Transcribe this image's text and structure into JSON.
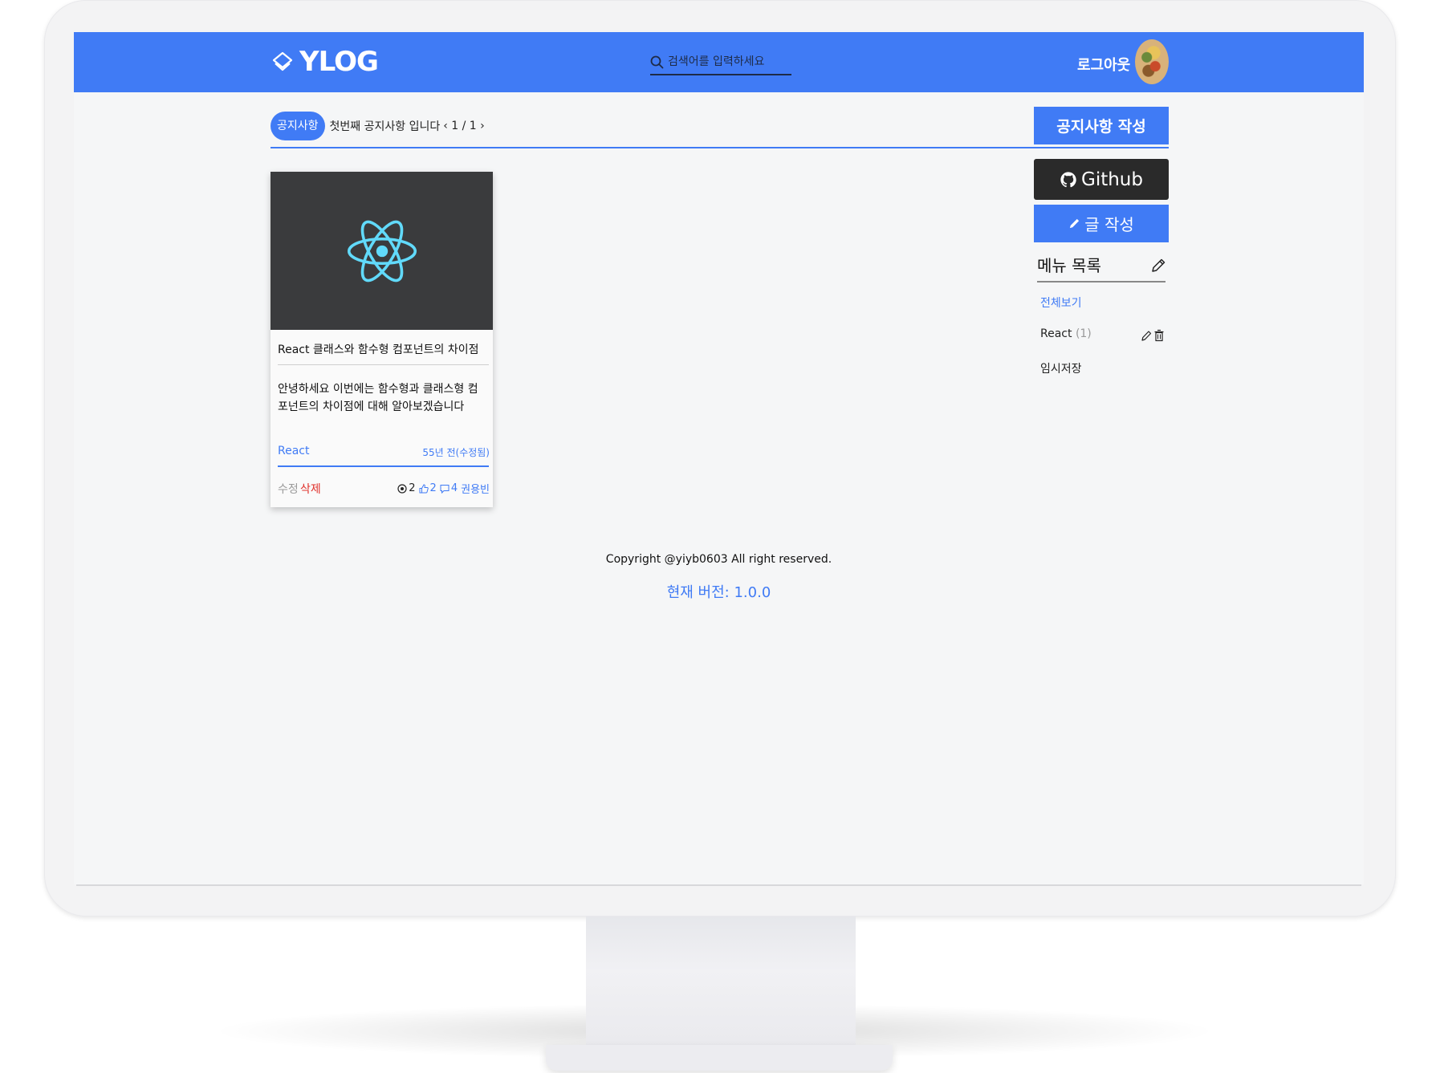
{
  "header": {
    "logo_text": "YLOG",
    "logo_icon": "layers-diamond-icon",
    "search_placeholder": "검색어를 입력하세요",
    "logout_label": "로그아웃",
    "brand_color": "#407bf5"
  },
  "notice": {
    "badge": "공지사항",
    "text": "첫번째 공지사항 입니다",
    "pager": "‹ 1 / 1 ›"
  },
  "sidebar": {
    "notice_write_label": "공지사항 작성",
    "github_label": "Github",
    "write_label": "글 작성",
    "menu_title": "메뉴 목록",
    "menu": {
      "all": "전체보기",
      "react": "React",
      "react_count": "(1)",
      "temp": "임시저장"
    }
  },
  "post": {
    "thumbnail_icon": "react-logo-icon",
    "title": "React 클래스와 함수형 컴포넌트의 차이점",
    "summary": "안녕하세요 이번에는 함수형과 클래스형 컴포넌트의 차이점에 대해 알아보겠습니다",
    "tag": "React",
    "date": "55년 전(수정됨)",
    "edit_label": "수정",
    "delete_label": "삭제",
    "views": "2",
    "likes": "2",
    "comments": "4",
    "author": "권용빈"
  },
  "footer": {
    "copyright": "Copyright @yiyb0603 All right reserved.",
    "version": "현재 버전: 1.0.0"
  }
}
